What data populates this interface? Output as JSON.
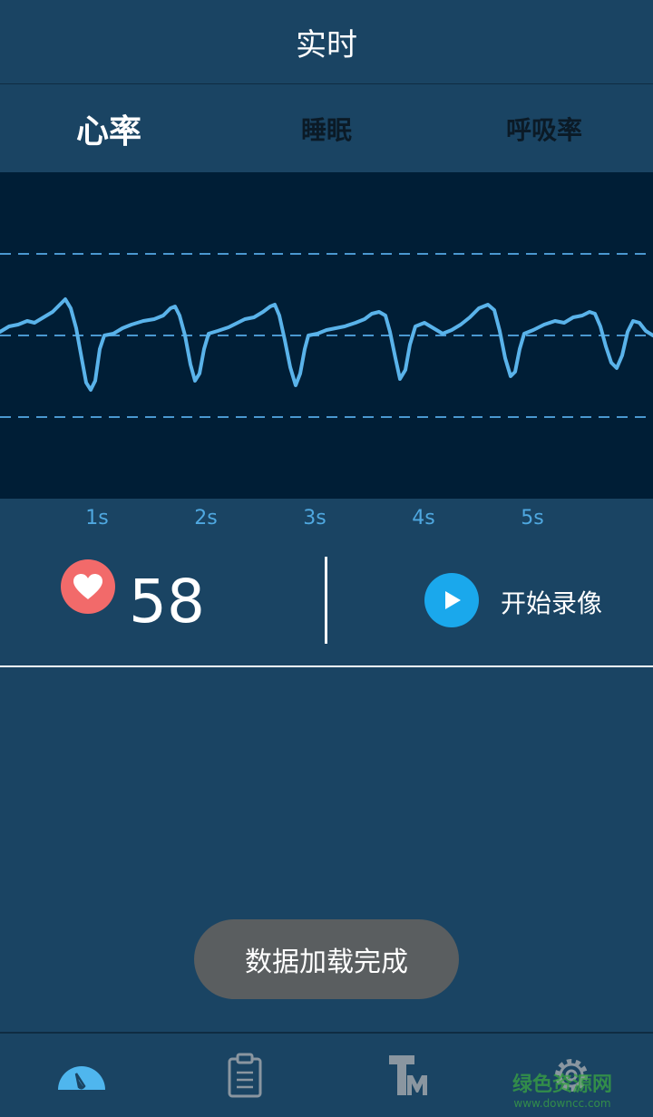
{
  "header": {
    "title": "实时"
  },
  "tabs": [
    {
      "label": "心率",
      "active": true
    },
    {
      "label": "睡眠",
      "active": false
    },
    {
      "label": "呼吸率",
      "active": false
    }
  ],
  "chart": {
    "line_color": "#5ab3ea",
    "time_ticks": [
      "1s",
      "2s",
      "3s",
      "4s",
      "5s"
    ]
  },
  "heart_rate": {
    "value": "58",
    "icon": "heart-icon",
    "color": "#f26a6a"
  },
  "record": {
    "label": "开始录像",
    "icon": "play-icon",
    "color": "#1aa8ec"
  },
  "toast": {
    "message": "数据加载完成"
  },
  "nav": [
    {
      "name": "realtime",
      "icon": "gauge-icon",
      "active": true
    },
    {
      "name": "report",
      "icon": "clipboard-icon",
      "active": false
    },
    {
      "name": "tm",
      "icon": "tm-logo-icon",
      "active": false
    },
    {
      "name": "settings",
      "icon": "gear-icon",
      "active": false
    }
  ],
  "watermark": {
    "main": "绿色资源网",
    "sub": "www.downcc.com"
  }
}
